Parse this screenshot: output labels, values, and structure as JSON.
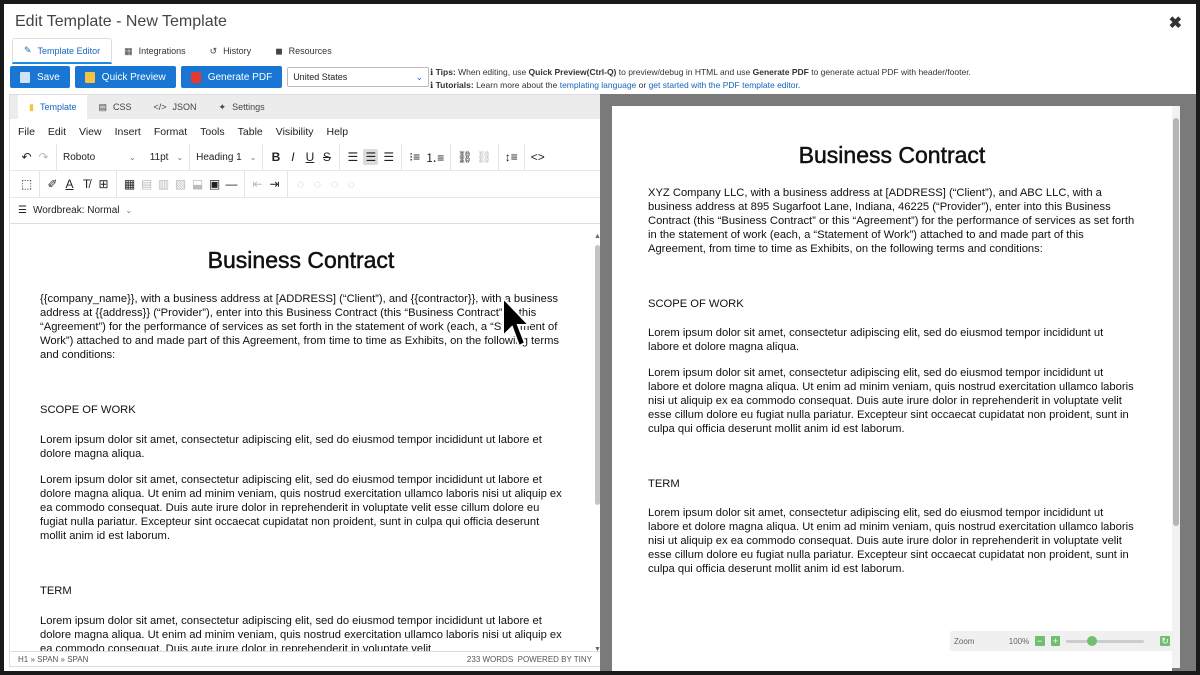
{
  "window": {
    "title": "Edit Template - New Template",
    "close_glyph": "✖"
  },
  "top_tabs": [
    {
      "label": "Template Editor",
      "icon": "pencil-icon",
      "glyph": "✎"
    },
    {
      "label": "Integrations",
      "icon": "table-icon",
      "glyph": "▦"
    },
    {
      "label": "History",
      "icon": "history-icon",
      "glyph": "↺"
    },
    {
      "label": "Resources",
      "icon": "book-icon",
      "glyph": "◼"
    }
  ],
  "actions": {
    "save": "Save",
    "quick_preview": "Quick Preview",
    "generate_pdf": "Generate PDF",
    "country": "United States"
  },
  "tips": {
    "tips_label": "Tips:",
    "tips_text_1": " When editing, use ",
    "tips_bold_1": "Quick Preview(Ctrl-Q)",
    "tips_text_2": " to preview/debug in HTML and use ",
    "tips_bold_2": "Generate PDF",
    "tips_text_3": " to generate actual PDF with header/footer.",
    "tutorials_label": "Tutorials:",
    "tutorials_text_1": " Learn more about the ",
    "tutorials_link_1": "templating language",
    "tutorials_text_2": " or ",
    "tutorials_link_2": "get started with the PDF template editor",
    "tutorials_text_3": "."
  },
  "editor_tabs": [
    {
      "label": "Template",
      "glyph": "▮"
    },
    {
      "label": "CSS",
      "glyph": "▤"
    },
    {
      "label": "JSON",
      "glyph": "</>"
    },
    {
      "label": "Settings",
      "glyph": "✦"
    }
  ],
  "menu": [
    "File",
    "Edit",
    "View",
    "Insert",
    "Format",
    "Tools",
    "Table",
    "Visibility",
    "Help"
  ],
  "toolbar": {
    "font": "Roboto",
    "size": "11pt",
    "block": "Heading 1",
    "wordbreak": "Wordbreak: Normal"
  },
  "editor_doc": {
    "title": "Business Contract",
    "intro": "{{company_name}}, with a business address at [ADDRESS] (“Client”), and {{contractor}}, with a business address at {{address}} (“Provider”), enter into this Business Contract (this “Business Contract” or this “Agreement”) for the performance of services as set forth in the statement of work (each, a “Statement of Work”) attached to and made part of this Agreement, from time to time as Exhibits, on the following terms and conditions:",
    "scope_heading": "SCOPE OF WORK",
    "scope_p1": "Lorem ipsum dolor sit amet, consectetur adipiscing elit, sed do eiusmod tempor incididunt ut labore et dolore magna aliqua.",
    "scope_p2": "Lorem ipsum dolor sit amet, consectetur adipiscing elit, sed do eiusmod tempor incididunt ut labore et dolore magna aliqua. Ut enim ad minim veniam, quis nostrud exercitation ullamco laboris nisi ut aliquip ex ea commodo consequat. Duis aute irure dolor in reprehenderit in voluptate velit esse cillum dolore eu fugiat nulla pariatur. Excepteur sint occaecat cupidatat non proident, sunt in culpa qui officia deserunt mollit anim id est laborum.",
    "term_heading": "TERM",
    "term_p1": "Lorem ipsum dolor sit amet, consectetur adipiscing elit, sed do eiusmod tempor incididunt ut labore et dolore magna aliqua. Ut enim ad minim veniam, quis nostrud exercitation ullamco laboris nisi ut aliquip ex ea commodo consequat. Duis aute irure dolor in reprehenderit in voluptate velit"
  },
  "status": {
    "path": "H1 » SPAN » SPAN",
    "words": "233 WORDS",
    "powered": "POWERED BY TINY"
  },
  "preview_doc": {
    "title": "Business Contract",
    "intro": "XYZ Company LLC, with a business address at [ADDRESS] (“Client”), and ABC LLC, with a business address at 895 Sugarfoot Lane, Indiana, 46225 (“Provider”), enter into this Business Contract (this “Business Contract” or this “Agreement”) for the performance of services as set forth in the statement of work (each, a “Statement of Work”) attached to and made part of this Agreement, from time to time as Exhibits, on the following terms and conditions:",
    "scope_heading": "SCOPE OF WORK",
    "scope_p1": "Lorem ipsum dolor sit amet, consectetur adipiscing elit, sed do eiusmod tempor incididunt ut labore et dolore magna aliqua.",
    "scope_p2": "Lorem ipsum dolor sit amet, consectetur adipiscing elit, sed do eiusmod tempor incididunt ut labore et dolore magna aliqua. Ut enim ad minim veniam, quis nostrud exercitation ullamco laboris nisi ut aliquip ex ea commodo consequat. Duis aute irure dolor in reprehenderit in voluptate velit esse cillum dolore eu fugiat nulla pariatur. Excepteur sint occaecat cupidatat non proident, sunt in culpa qui officia deserunt mollit anim id est laborum.",
    "term_heading": "TERM",
    "term_p1": "Lorem ipsum dolor sit amet, consectetur adipiscing elit, sed do eiusmod tempor incididunt ut labore et dolore magna aliqua. Ut enim ad minim veniam, quis nostrud exercitation ullamco laboris nisi ut aliquip ex ea commodo consequat. Duis aute irure dolor in reprehenderit in voluptate velit esse cillum dolore eu fugiat nulla pariatur. Excepteur sint occaecat cupidatat non proident, sunt in culpa qui officia deserunt mollit anim id est laborum."
  },
  "zoom": {
    "label": "Zoom",
    "value": "100%",
    "slider_level": 0.3
  },
  "colors": {
    "primary": "#1976d2",
    "link": "#1565c0",
    "zoom_green": "#6fbf6f",
    "preview_bg": "#7a7a7a"
  }
}
